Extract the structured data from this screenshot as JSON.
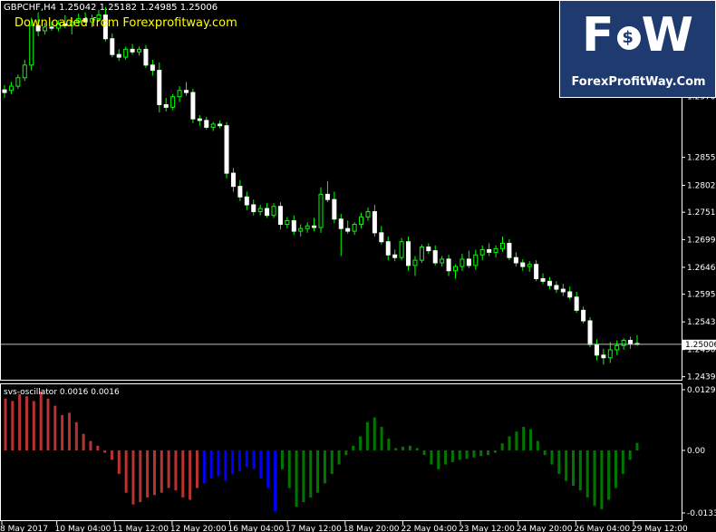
{
  "header": {
    "symbol_line": "GBPCHF,H4  1.25042 1.25182 1.24985 1.25006",
    "watermark": "Downloaded from Forexprofitway.com"
  },
  "logo": {
    "letters": [
      "F",
      "$",
      "W"
    ],
    "site": "ForexProfitWay.Com",
    "bg_color": "#1f3a6e"
  },
  "colors": {
    "candle": "#ffffff",
    "wick": "#00ff00",
    "osc_red": "#b83232",
    "osc_blue": "#0000ff",
    "osc_green": "#007800",
    "axis_text": "#ffffff"
  },
  "chart_data": [
    {
      "type": "candlestick",
      "symbol": "GBPCHF",
      "timeframe": "H4",
      "current_price": "1.25006",
      "ylim": [
        1.2435,
        1.315
      ],
      "y_ticks": [
        "1.29705",
        "1.28550",
        "1.28020",
        "1.27510",
        "1.26990",
        "1.26465",
        "1.25955",
        "1.25430",
        "1.24905",
        "1.24390"
      ],
      "y_tick_values": [
        1.29705,
        1.2855,
        1.2802,
        1.2751,
        1.2699,
        1.26465,
        1.25955,
        1.2543,
        1.24905,
        1.2439
      ],
      "candles": [
        {
          "o": 1.2983,
          "h": 1.2992,
          "l": 1.2968,
          "c": 1.2978
        },
        {
          "o": 1.2982,
          "h": 1.2998,
          "l": 1.2975,
          "c": 1.299
        },
        {
          "o": 1.299,
          "h": 1.3012,
          "l": 1.2985,
          "c": 1.3006
        },
        {
          "o": 1.3006,
          "h": 1.304,
          "l": 1.3,
          "c": 1.303
        },
        {
          "o": 1.303,
          "h": 1.312,
          "l": 1.302,
          "c": 1.3105
        },
        {
          "o": 1.3105,
          "h": 1.313,
          "l": 1.3085,
          "c": 1.3095
        },
        {
          "o": 1.3095,
          "h": 1.311,
          "l": 1.3088,
          "c": 1.3102
        },
        {
          "o": 1.3102,
          "h": 1.3112,
          "l": 1.3095,
          "c": 1.31
        },
        {
          "o": 1.31,
          "h": 1.3115,
          "l": 1.3094,
          "c": 1.3108
        },
        {
          "o": 1.3108,
          "h": 1.3125,
          "l": 1.31,
          "c": 1.3105
        },
        {
          "o": 1.3105,
          "h": 1.312,
          "l": 1.3088,
          "c": 1.3112
        },
        {
          "o": 1.3112,
          "h": 1.3128,
          "l": 1.3105,
          "c": 1.3118
        },
        {
          "o": 1.3118,
          "h": 1.313,
          "l": 1.311,
          "c": 1.3112
        },
        {
          "o": 1.3112,
          "h": 1.3126,
          "l": 1.3102,
          "c": 1.3118
        },
        {
          "o": 1.3118,
          "h": 1.3135,
          "l": 1.3112,
          "c": 1.3125
        },
        {
          "o": 1.3125,
          "h": 1.314,
          "l": 1.3075,
          "c": 1.308
        },
        {
          "o": 1.308,
          "h": 1.309,
          "l": 1.3045,
          "c": 1.305
        },
        {
          "o": 1.305,
          "h": 1.306,
          "l": 1.3038,
          "c": 1.3045
        },
        {
          "o": 1.3045,
          "h": 1.3065,
          "l": 1.304,
          "c": 1.306
        },
        {
          "o": 1.306,
          "h": 1.307,
          "l": 1.305,
          "c": 1.3055
        },
        {
          "o": 1.3055,
          "h": 1.3065,
          "l": 1.3048,
          "c": 1.306
        },
        {
          "o": 1.306,
          "h": 1.3068,
          "l": 1.3025,
          "c": 1.303
        },
        {
          "o": 1.303,
          "h": 1.304,
          "l": 1.301,
          "c": 1.302
        },
        {
          "o": 1.302,
          "h": 1.3035,
          "l": 1.294,
          "c": 1.2955
        },
        {
          "o": 1.2955,
          "h": 1.2968,
          "l": 1.2942,
          "c": 1.295
        },
        {
          "o": 1.295,
          "h": 1.2975,
          "l": 1.2945,
          "c": 1.297
        },
        {
          "o": 1.297,
          "h": 1.299,
          "l": 1.296,
          "c": 1.2982
        },
        {
          "o": 1.2982,
          "h": 1.2998,
          "l": 1.2972,
          "c": 1.2978
        },
        {
          "o": 1.2978,
          "h": 1.2985,
          "l": 1.292,
          "c": 1.2928
        },
        {
          "o": 1.2928,
          "h": 1.2935,
          "l": 1.2915,
          "c": 1.2925
        },
        {
          "o": 1.2925,
          "h": 1.2932,
          "l": 1.2908,
          "c": 1.2912
        },
        {
          "o": 1.2912,
          "h": 1.2922,
          "l": 1.2905,
          "c": 1.2918
        },
        {
          "o": 1.2918,
          "h": 1.2925,
          "l": 1.291,
          "c": 1.2915
        },
        {
          "o": 1.2915,
          "h": 1.2922,
          "l": 1.2815,
          "c": 1.2825
        },
        {
          "o": 1.2825,
          "h": 1.2835,
          "l": 1.279,
          "c": 1.28
        },
        {
          "o": 1.28,
          "h": 1.2812,
          "l": 1.2772,
          "c": 1.278
        },
        {
          "o": 1.278,
          "h": 1.279,
          "l": 1.2755,
          "c": 1.2765
        },
        {
          "o": 1.2765,
          "h": 1.2775,
          "l": 1.2745,
          "c": 1.2752
        },
        {
          "o": 1.2752,
          "h": 1.2765,
          "l": 1.2745,
          "c": 1.2758
        },
        {
          "o": 1.2758,
          "h": 1.2768,
          "l": 1.274,
          "c": 1.2745
        },
        {
          "o": 1.2745,
          "h": 1.2768,
          "l": 1.274,
          "c": 1.2762
        },
        {
          "o": 1.2762,
          "h": 1.277,
          "l": 1.2718,
          "c": 1.2728
        },
        {
          "o": 1.2728,
          "h": 1.2742,
          "l": 1.272,
          "c": 1.2735
        },
        {
          "o": 1.2735,
          "h": 1.2745,
          "l": 1.2708,
          "c": 1.2715
        },
        {
          "o": 1.2715,
          "h": 1.2728,
          "l": 1.2705,
          "c": 1.272
        },
        {
          "o": 1.272,
          "h": 1.2732,
          "l": 1.2712,
          "c": 1.2725
        },
        {
          "o": 1.2725,
          "h": 1.274,
          "l": 1.2715,
          "c": 1.2722
        },
        {
          "o": 1.2722,
          "h": 1.2798,
          "l": 1.2712,
          "c": 1.2785
        },
        {
          "o": 1.2785,
          "h": 1.281,
          "l": 1.277,
          "c": 1.2775
        },
        {
          "o": 1.2775,
          "h": 1.279,
          "l": 1.273,
          "c": 1.2738
        },
        {
          "o": 1.2738,
          "h": 1.2748,
          "l": 1.2668,
          "c": 1.272
        },
        {
          "o": 1.272,
          "h": 1.2735,
          "l": 1.271,
          "c": 1.2715
        },
        {
          "o": 1.2715,
          "h": 1.2732,
          "l": 1.2708,
          "c": 1.2728
        },
        {
          "o": 1.2728,
          "h": 1.275,
          "l": 1.272,
          "c": 1.2742
        },
        {
          "o": 1.2742,
          "h": 1.276,
          "l": 1.2735,
          "c": 1.2752
        },
        {
          "o": 1.2752,
          "h": 1.2765,
          "l": 1.2705,
          "c": 1.2712
        },
        {
          "o": 1.2712,
          "h": 1.2725,
          "l": 1.269,
          "c": 1.2695
        },
        {
          "o": 1.2695,
          "h": 1.2705,
          "l": 1.266,
          "c": 1.267
        },
        {
          "o": 1.267,
          "h": 1.268,
          "l": 1.2658,
          "c": 1.2665
        },
        {
          "o": 1.2665,
          "h": 1.2702,
          "l": 1.266,
          "c": 1.2695
        },
        {
          "o": 1.2695,
          "h": 1.2705,
          "l": 1.264,
          "c": 1.265
        },
        {
          "o": 1.265,
          "h": 1.2668,
          "l": 1.263,
          "c": 1.266
        },
        {
          "o": 1.266,
          "h": 1.269,
          "l": 1.2655,
          "c": 1.2685
        },
        {
          "o": 1.2685,
          "h": 1.2692,
          "l": 1.2672,
          "c": 1.2678
        },
        {
          "o": 1.2678,
          "h": 1.2688,
          "l": 1.265,
          "c": 1.2655
        },
        {
          "o": 1.2655,
          "h": 1.2668,
          "l": 1.2648,
          "c": 1.2662
        },
        {
          "o": 1.2662,
          "h": 1.267,
          "l": 1.263,
          "c": 1.264
        },
        {
          "o": 1.264,
          "h": 1.2652,
          "l": 1.2625,
          "c": 1.2648
        },
        {
          "o": 1.2648,
          "h": 1.2672,
          "l": 1.264,
          "c": 1.2662
        },
        {
          "o": 1.2662,
          "h": 1.2678,
          "l": 1.2645,
          "c": 1.265
        },
        {
          "o": 1.265,
          "h": 1.268,
          "l": 1.2642,
          "c": 1.267
        },
        {
          "o": 1.267,
          "h": 1.2688,
          "l": 1.266,
          "c": 1.268
        },
        {
          "o": 1.268,
          "h": 1.2692,
          "l": 1.2668,
          "c": 1.2675
        },
        {
          "o": 1.2675,
          "h": 1.2688,
          "l": 1.2665,
          "c": 1.2682
        },
        {
          "o": 1.2682,
          "h": 1.2705,
          "l": 1.2676,
          "c": 1.2692
        },
        {
          "o": 1.2692,
          "h": 1.27,
          "l": 1.266,
          "c": 1.2665
        },
        {
          "o": 1.2665,
          "h": 1.2675,
          "l": 1.2648,
          "c": 1.2655
        },
        {
          "o": 1.2655,
          "h": 1.2662,
          "l": 1.264,
          "c": 1.2648
        },
        {
          "o": 1.2648,
          "h": 1.2658,
          "l": 1.2638,
          "c": 1.2652
        },
        {
          "o": 1.2652,
          "h": 1.266,
          "l": 1.262,
          "c": 1.2625
        },
        {
          "o": 1.2625,
          "h": 1.2635,
          "l": 1.2615,
          "c": 1.262
        },
        {
          "o": 1.262,
          "h": 1.2628,
          "l": 1.2605,
          "c": 1.2612
        },
        {
          "o": 1.2612,
          "h": 1.262,
          "l": 1.2598,
          "c": 1.2605
        },
        {
          "o": 1.2605,
          "h": 1.2615,
          "l": 1.2592,
          "c": 1.26
        },
        {
          "o": 1.26,
          "h": 1.261,
          "l": 1.2585,
          "c": 1.259
        },
        {
          "o": 1.259,
          "h": 1.26,
          "l": 1.256,
          "c": 1.2565
        },
        {
          "o": 1.2565,
          "h": 1.2572,
          "l": 1.254,
          "c": 1.2545
        },
        {
          "o": 1.2545,
          "h": 1.2552,
          "l": 1.2495,
          "c": 1.25
        },
        {
          "o": 1.25,
          "h": 1.251,
          "l": 1.247,
          "c": 1.248
        },
        {
          "o": 1.248,
          "h": 1.2492,
          "l": 1.2462,
          "c": 1.2475
        },
        {
          "o": 1.2475,
          "h": 1.2505,
          "l": 1.2465,
          "c": 1.249
        },
        {
          "o": 1.249,
          "h": 1.2508,
          "l": 1.248,
          "c": 1.2498
        },
        {
          "o": 1.2498,
          "h": 1.2512,
          "l": 1.249,
          "c": 1.2508
        },
        {
          "o": 1.2508,
          "h": 1.2515,
          "l": 1.2492,
          "c": 1.2502
        },
        {
          "o": 1.2502,
          "h": 1.2518,
          "l": 1.2498,
          "c": 1.25006
        }
      ]
    },
    {
      "type": "bar",
      "title": "svs-oscillator 0.0016 0.0016",
      "ylim": [
        -0.0133,
        0.0129
      ],
      "y_ticks": [
        "0.0129",
        "0.00",
        "-0.0133"
      ],
      "y_tick_values": [
        0.0129,
        0.0,
        -0.0133
      ],
      "x_tick_labels": [
        "8 May 2017",
        "10 May 04:00",
        "11 May 12:00",
        "12 May 20:00",
        "16 May 04:00",
        "17 May 12:00",
        "18 May 20:00",
        "22 May 04:00",
        "23 May 12:00",
        "24 May 20:00",
        "26 May 04:00",
        "29 May 12:00"
      ],
      "series": [
        {
          "color": "#b83232",
          "values": [
            0.011,
            0.0105,
            0.012,
            0.0115,
            0.0105,
            0.0125,
            0.011,
            0.0095,
            0.0075,
            0.008,
            0.006,
            0.0035,
            0.002,
            0.001,
            -0.0005,
            -0.002,
            -0.005,
            -0.009,
            -0.0115,
            -0.011,
            -0.01,
            -0.0095,
            -0.009,
            -0.008,
            -0.0085,
            -0.01,
            -0.0105,
            -0.008
          ]
        },
        {
          "color": "#0000ff",
          "values": [
            -0.007,
            -0.006,
            -0.0055,
            -0.0065,
            -0.005,
            -0.0045,
            -0.0035,
            -0.004,
            -0.006,
            -0.008,
            -0.013
          ]
        },
        {
          "color": "#007800",
          "values": [
            -0.004,
            -0.008,
            -0.012,
            -0.011,
            -0.01,
            -0.009,
            -0.007,
            -0.005,
            -0.003,
            -0.001,
            0.001,
            0.003,
            0.006,
            0.007,
            0.005,
            0.0025,
            0.0005,
            0.0008,
            0.001,
            0.0005,
            -0.001,
            -0.003,
            -0.004,
            -0.003,
            -0.0025,
            -0.002,
            -0.0018,
            -0.0015,
            -0.0012,
            -0.001,
            -0.0005,
            0.0015,
            0.003,
            0.004,
            0.005,
            0.0045,
            0.002,
            -0.001,
            -0.003,
            -0.005,
            -0.0065,
            -0.0075,
            -0.0085,
            -0.01,
            -0.0118,
            -0.0125,
            -0.0105,
            -0.008,
            -0.005,
            -0.002,
            0.0016
          ]
        }
      ]
    }
  ]
}
